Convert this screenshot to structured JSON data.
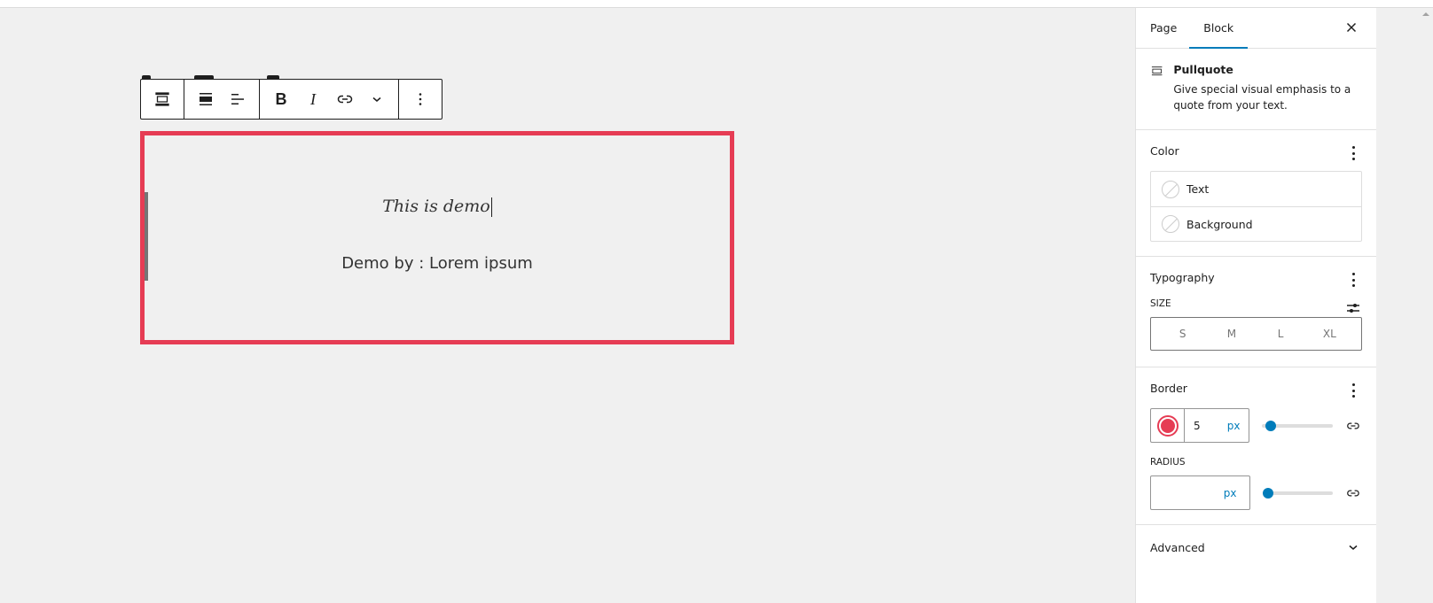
{
  "toolbar": {
    "buttons": [
      {
        "name": "block-type-pullquote",
        "icon": "pullquote-icon"
      },
      {
        "name": "align-wide",
        "icon": "align-wide-icon"
      },
      {
        "name": "text-align-left",
        "icon": "align-left-icon"
      },
      {
        "name": "bold",
        "label": "B"
      },
      {
        "name": "italic",
        "label": "I"
      },
      {
        "name": "link",
        "icon": "link-icon"
      },
      {
        "name": "more-rich-text",
        "icon": "chevron-down-icon"
      },
      {
        "name": "options",
        "icon": "more-vertical-icon"
      }
    ],
    "bold_label": "B",
    "italic_label": "I"
  },
  "block": {
    "quote": "This is demo",
    "citation": "Demo by : Lorem ipsum",
    "border_color": "#e63c54"
  },
  "sidebar": {
    "tabs": [
      {
        "label": "Page",
        "active": false
      },
      {
        "label": "Block",
        "active": true
      }
    ],
    "block_card": {
      "title": "Pullquote",
      "description": "Give special visual emphasis to a quote from your text."
    },
    "color": {
      "title": "Color",
      "items": [
        {
          "label": "Text"
        },
        {
          "label": "Background"
        }
      ]
    },
    "typography": {
      "title": "Typography",
      "size_label": "SIZE",
      "sizes": [
        "S",
        "M",
        "L",
        "XL"
      ]
    },
    "border": {
      "title": "Border",
      "color": "#e63c54",
      "width_value": "5",
      "width_unit": "px",
      "width_slider_fraction": 0.05,
      "radius_label": "RADIUS",
      "radius_value": "",
      "radius_unit": "px",
      "radius_slider_fraction": 0.0
    },
    "advanced": {
      "title": "Advanced"
    }
  },
  "colors": {
    "accent": "#007cba",
    "border_highlight": "#e63c54"
  }
}
